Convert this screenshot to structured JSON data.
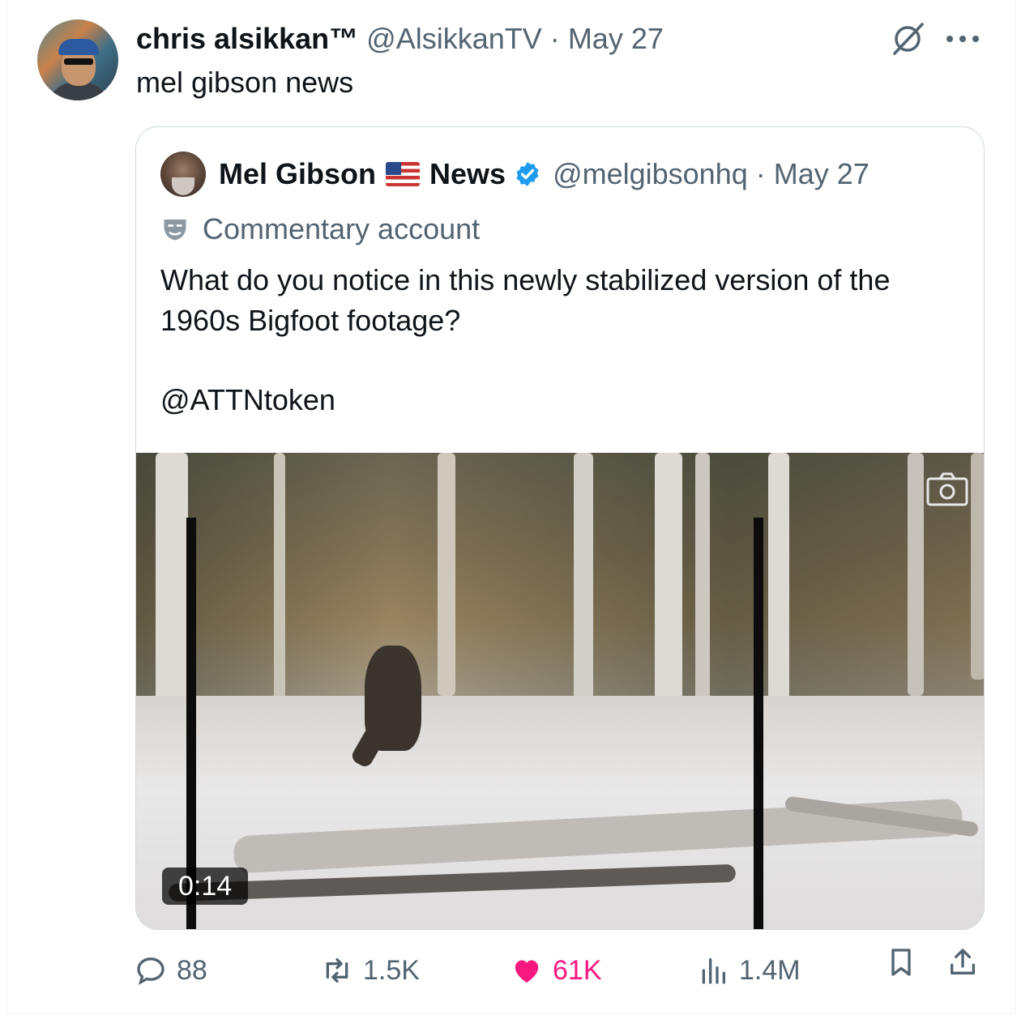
{
  "tweet": {
    "author_name": "chris alsikkan™",
    "author_handle": "@AlsikkanTV",
    "separator": "·",
    "date": "May 27",
    "text": "mel gibson news"
  },
  "quoted_tweet": {
    "name_part1": "Mel Gibson",
    "name_part2": "News",
    "handle": "@melgibsonhq",
    "separator": "·",
    "date": "May 27",
    "label": "Commentary account",
    "text": "What do you notice in this newly stabilized version of the 1960s Bigfoot footage?",
    "mention": "@ATTNtoken",
    "video_duration": "0:14"
  },
  "actions": {
    "replies": "88",
    "reposts": "1.5K",
    "likes": "61K",
    "views": "1.4M"
  },
  "colors": {
    "text_primary": "#0f1419",
    "text_secondary": "#536471",
    "verified_blue": "#1d9bf0",
    "like_pink": "#f91880",
    "border": "#cfd9de"
  },
  "icons": [
    "grok-icon",
    "more-icon",
    "flag-us-icon",
    "verified-badge-icon",
    "commentary-mask-icon",
    "camera-icon",
    "reply-icon",
    "repost-icon",
    "like-icon",
    "views-icon",
    "bookmark-icon",
    "share-icon"
  ]
}
